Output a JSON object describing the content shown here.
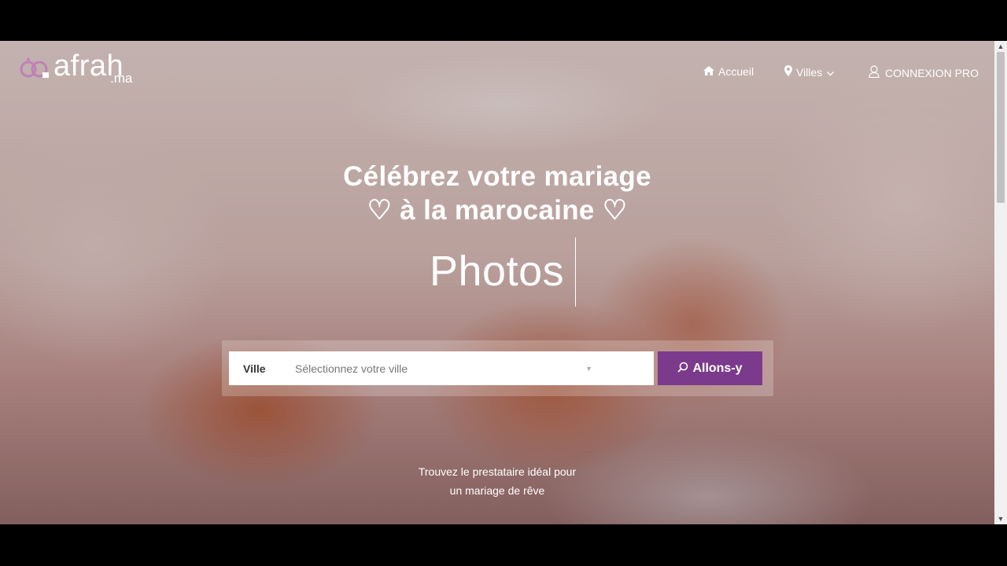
{
  "brand": {
    "name": "afrah",
    "suffix": ".ma",
    "logo_accent": "#c080b8"
  },
  "nav": {
    "home": "Accueil",
    "villes": "Villes",
    "pro": "CONNEXION PRO"
  },
  "hero": {
    "title_line1": "Célébrez votre mariage",
    "title_line2": "♡ à la marocaine ♡",
    "rotating_word": "Photos"
  },
  "search": {
    "label": "Ville",
    "placeholder": "Sélectionnez votre ville",
    "button": "Allons-y",
    "button_color": "#7b3a8c"
  },
  "tagline": {
    "line1": "Trouvez le prestataire idéal pour",
    "line2": "un mariage de rêve"
  },
  "icons": {
    "home": "home-icon",
    "location": "map-marker-icon",
    "chevron": "chevron-down-icon",
    "user": "user-icon",
    "search": "search-icon"
  }
}
